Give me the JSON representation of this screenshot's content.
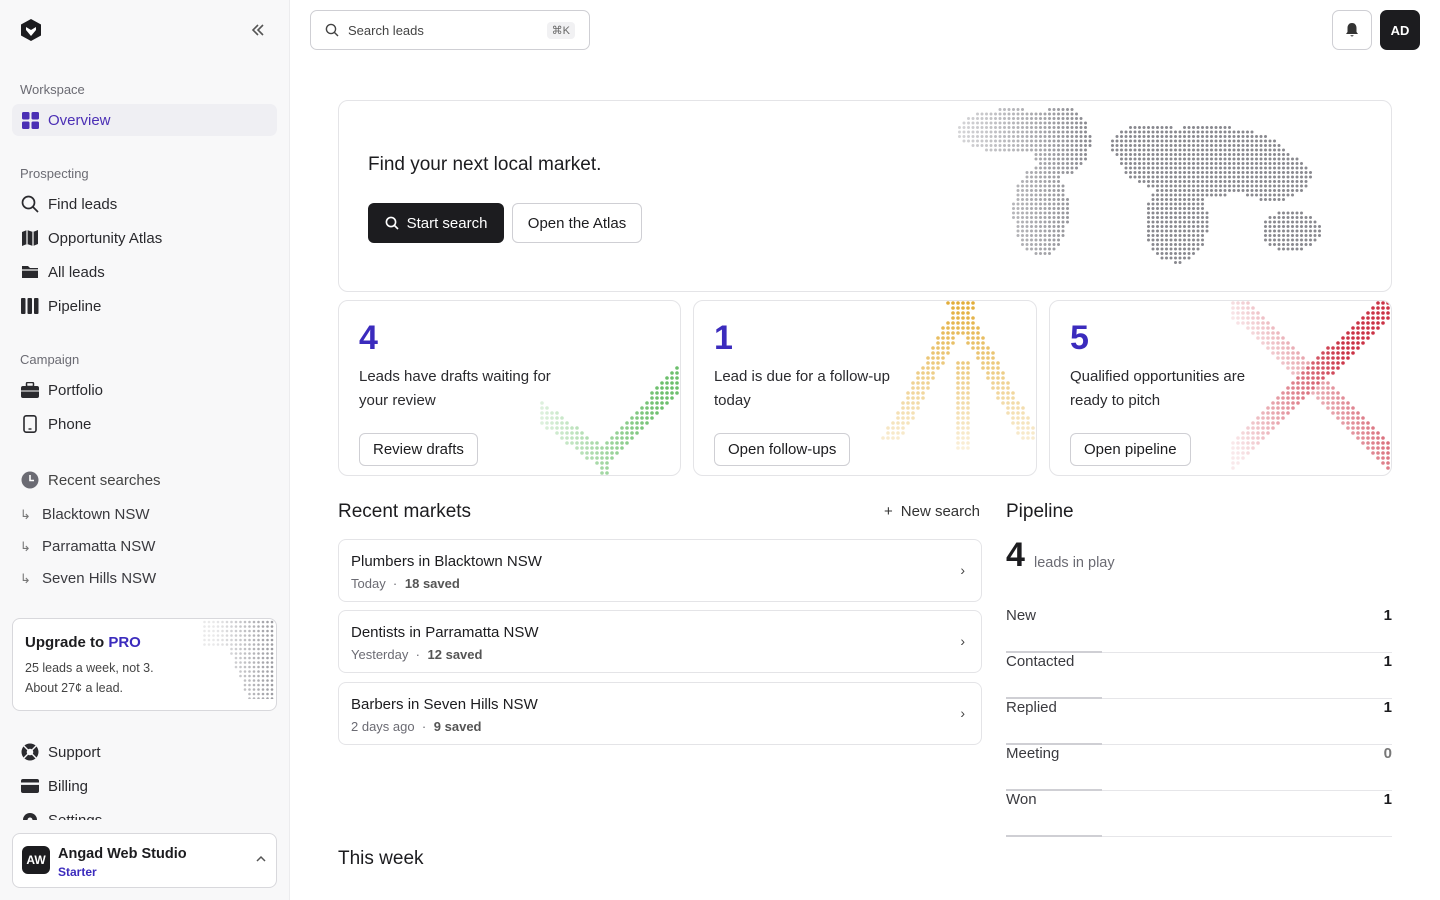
{
  "sidebar": {
    "sections": {
      "workspace": "Workspace",
      "prospecting": "Prospecting",
      "campaign": "Campaign"
    },
    "items": {
      "overview": "Overview",
      "find_leads": "Find leads",
      "atlas": "Opportunity Atlas",
      "all_leads": "All leads",
      "pipeline": "Pipeline",
      "portfolio": "Portfolio",
      "phone": "Phone",
      "recent": "Recent searches",
      "support": "Support",
      "billing": "Billing",
      "settings": "Settings"
    },
    "recent_searches": [
      "Blacktown NSW",
      "Parramatta NSW",
      "Seven Hills NSW"
    ],
    "upgrade": {
      "title": "Upgrade to",
      "pro": "PRO",
      "line1": "25 leads a week, not 3.",
      "line2": "About 27¢ a lead."
    },
    "account": {
      "initials": "AW",
      "name": "Angad Web Studio",
      "plan": "Starter"
    }
  },
  "topbar": {
    "search_placeholder": "Search leads",
    "shortcut": "⌘K",
    "user_initials": "AD"
  },
  "hero": {
    "title": "Find your next local market.",
    "primary": "Start search",
    "secondary": "Open the Atlas"
  },
  "cards": [
    {
      "number": "4",
      "text": "Leads have drafts waiting for your review",
      "button": "Review drafts",
      "color": "#5cb85c"
    },
    {
      "number": "1",
      "text": "Lead is due for a follow-up today",
      "button": "Open follow-ups",
      "color": "#e0a82e"
    },
    {
      "number": "5",
      "text": "Qualified opportunities are ready to pitch",
      "button": "Open pipeline",
      "color": "#c8283c"
    }
  ],
  "recent_markets": {
    "title": "Recent markets",
    "new_search": "New search",
    "items": [
      {
        "title": "Plumbers in Blacktown NSW",
        "when": "Today",
        "saved": "18 saved"
      },
      {
        "title": "Dentists in Parramatta NSW",
        "when": "Yesterday",
        "saved": "12 saved"
      },
      {
        "title": "Barbers in Seven Hills NSW",
        "when": "2 days ago",
        "saved": "9 saved"
      }
    ]
  },
  "pipeline": {
    "title": "Pipeline",
    "count": "4",
    "label": "leads in play",
    "stages": [
      {
        "name": "New",
        "value": "1"
      },
      {
        "name": "Contacted",
        "value": "1"
      },
      {
        "name": "Replied",
        "value": "1"
      },
      {
        "name": "Meeting",
        "value": "0"
      },
      {
        "name": "Won",
        "value": "1"
      }
    ]
  },
  "this_week": {
    "title": "This week"
  },
  "colors": {
    "accent": "#3b2bbd",
    "dark": "#1c1c1f"
  }
}
